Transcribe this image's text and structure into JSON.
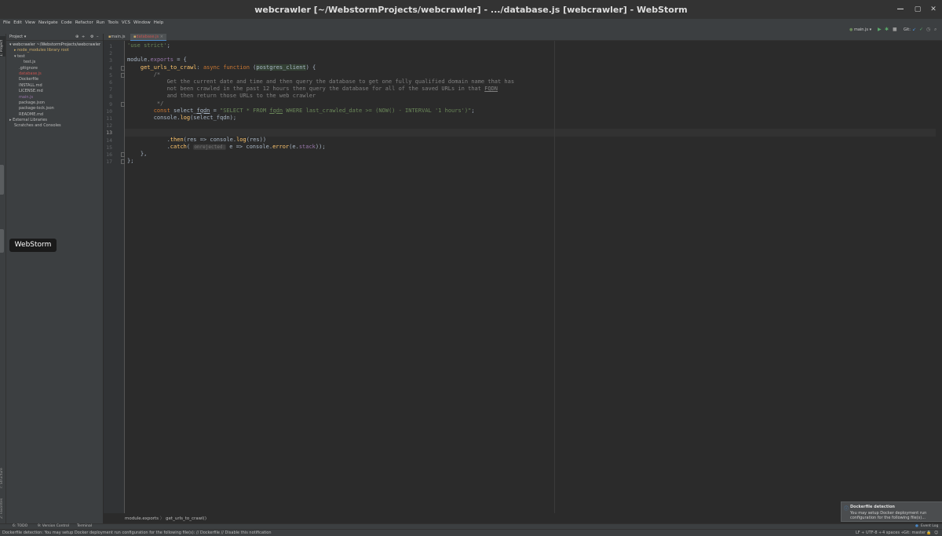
{
  "window": {
    "title": "webcrawler [~/WebstormProjects/webcrawler] - .../database.js [webcrawler] - WebStorm"
  },
  "menu": [
    "File",
    "Edit",
    "View",
    "Navigate",
    "Code",
    "Refactor",
    "Run",
    "Tools",
    "VCS",
    "Window",
    "Help"
  ],
  "toolbar": {
    "run_config": "main.js ▾",
    "git_label": "Git:"
  },
  "left_stripe": {
    "project": "1: Project",
    "structure": "7: Structure",
    "favorites": "2: Favorites"
  },
  "project_panel": {
    "header": "Project ▾",
    "tree": [
      {
        "label": "▾ webcrawler  ~/WebstormProjects/webcrawler",
        "indent": 0,
        "color": "#cccccc"
      },
      {
        "label": "▸ node_modules  library root",
        "indent": 1,
        "color": "#c8a969"
      },
      {
        "label": "▾ test",
        "indent": 1,
        "color": "#bbbbbb"
      },
      {
        "label": "test.js",
        "indent": 3,
        "color": "#bbbbbb"
      },
      {
        "label": ".gitignore",
        "indent": 2,
        "color": "#bbbbbb"
      },
      {
        "label": "database.js",
        "indent": 2,
        "color": "#c75450"
      },
      {
        "label": "Dockerfile",
        "indent": 2,
        "color": "#bbbbbb"
      },
      {
        "label": "INSTALL.md",
        "indent": 2,
        "color": "#bbbbbb"
      },
      {
        "label": "LICENSE.md",
        "indent": 2,
        "color": "#bbbbbb"
      },
      {
        "label": "main.js",
        "indent": 2,
        "color": "#9876aa"
      },
      {
        "label": "package.json",
        "indent": 2,
        "color": "#bbbbbb"
      },
      {
        "label": "package-lock.json",
        "indent": 2,
        "color": "#bbbbbb"
      },
      {
        "label": "README.md",
        "indent": 2,
        "color": "#bbbbbb"
      },
      {
        "label": "▸ External Libraries",
        "indent": 0,
        "color": "#bbbbbb"
      },
      {
        "label": "Scratches and Consoles",
        "indent": 1,
        "color": "#bbbbbb"
      }
    ]
  },
  "tabs": [
    {
      "label": "main.js",
      "active": false
    },
    {
      "label": "database.js",
      "active": true
    }
  ],
  "editor": {
    "current_line": 13,
    "lines": [
      {
        "n": "1",
        "html": "<span class=\"str\">'use strict'</span>;"
      },
      {
        "n": "2",
        "html": ""
      },
      {
        "n": "3",
        "html": "module.<span class=\"prop\">exports</span> = {"
      },
      {
        "n": "4",
        "html": "    <span class=\"fn\">get_urls_to_crawl</span>: <span class=\"kw\">async function</span> (<span class=\"par\">postgres_client</span>) {"
      },
      {
        "n": "5",
        "html": "        <span class=\"cm\">/*</span>"
      },
      {
        "n": "6",
        "html": "<span class=\"cm\">            Get the current date and time and then query the database to get one fully qualified domain name that has</span>"
      },
      {
        "n": "7",
        "html": "<span class=\"cm\">            not been crawled in the past 12 hours then query the database for all of the saved URLs in that <u>FQDN</u></span>"
      },
      {
        "n": "8",
        "html": "<span class=\"cm\">            and then return those URLs to the web crawler</span>"
      },
      {
        "n": "9",
        "html": "<span class=\"cm\">         */</span>"
      },
      {
        "n": "10",
        "html": "        <span class=\"kw\">const</span> select_<u>fqdn</u> = <span class=\"str\">\"SELECT * FROM <u>fqdn</u> WHERE last_crawled_date &gt;= (NOW() - INTERVAL '1 hours')\"</span>;"
      },
      {
        "n": "11",
        "html": "        console.<span class=\"fn\">log</span>(select_fqdn);"
      },
      {
        "n": "12",
        "html": ""
      },
      {
        "n": "13",
        "html": "        <span class=\"kw\">await</span> <span class=\"par\">postgres_client</span>.<span class=\"fn\">query</span>(select_fqdn)"
      },
      {
        "n": "14",
        "html": "            .<span class=\"fn\">then</span>(res =&gt; console.<span class=\"fn\">log</span>(res))"
      },
      {
        "n": "15",
        "html": "            .<span class=\"fn\">catch</span>( <span class=\"hint\">onrejected:</span> e =&gt; console.<span class=\"fn\">error</span>(e.<span class=\"prop\">stack</span>));"
      },
      {
        "n": "16",
        "html": "    },"
      },
      {
        "n": "17",
        "html": "};"
      }
    ]
  },
  "breadcrumb": [
    "module.exports",
    "get_urls_to_crawl()"
  ],
  "tooltip": "WebStorm",
  "bottom_tools": [
    "6: TODO",
    "9: Version Control",
    "Terminal"
  ],
  "event_log": "Event Log",
  "notification": {
    "title": "Dockerfile detection",
    "body1": "You may setup Docker deployment run",
    "body2": "configuration for the following file(s)..."
  },
  "status": {
    "message": "Dockerfile detection: You may setup Docker deployment run configuration for the following file(s): // Dockerfile // Disable this notification",
    "line_sep": "LF ÷",
    "encoding": "UTF-8 ÷",
    "indent": "4 spaces ÷",
    "git": "Git: master ÷"
  },
  "colors": {
    "background": "#2b2b2b",
    "panel": "#3c3f41",
    "keyword": "#cc7832",
    "string": "#6a8759",
    "function": "#ffc66d"
  }
}
